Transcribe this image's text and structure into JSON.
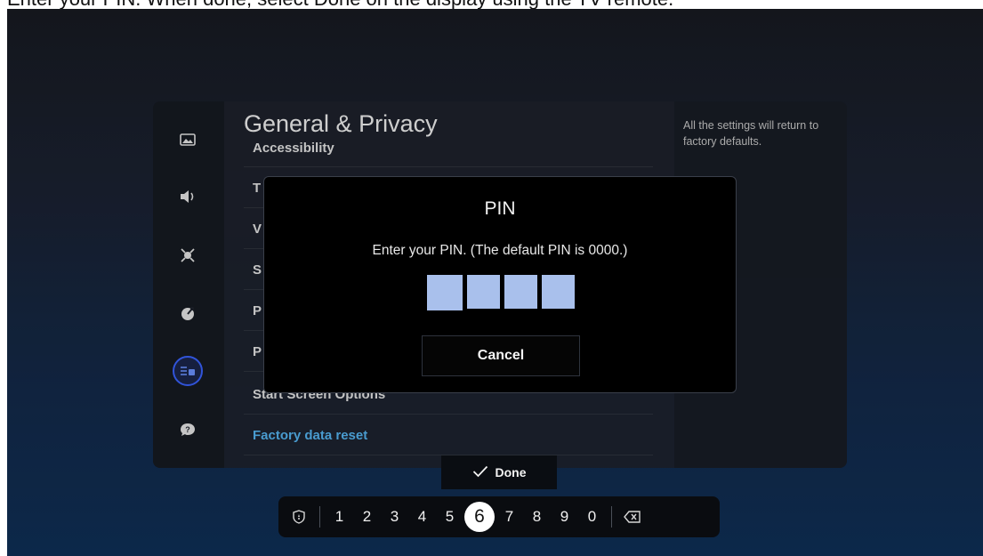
{
  "caption": "Enter your PIN. When done, select Done on the display using the TV remote.",
  "panel": {
    "title": "General & Privacy",
    "items": [
      "Accessibility",
      "T",
      "V",
      "S",
      "P",
      "P",
      "Start Screen Options",
      "Factory data reset"
    ],
    "active_item": "Factory data reset",
    "help_text": "All the settings will return to factory defaults."
  },
  "sidebar": {
    "icons": [
      "picture-icon",
      "sound-icon",
      "connection-icon",
      "broadcast-icon",
      "general-icon",
      "support-icon"
    ],
    "selected": "general-icon",
    "accent": "#3a63ff"
  },
  "dialog": {
    "title": "PIN",
    "message": "Enter your PIN. (The default PIN is 0000.)",
    "pin_length": 4,
    "cancel_label": "Cancel"
  },
  "done_label": "Done",
  "keypad": {
    "digits": [
      "1",
      "2",
      "3",
      "4",
      "5",
      "6",
      "7",
      "8",
      "9",
      "0"
    ],
    "focused": "6"
  },
  "colors": {
    "pin_box": "#a9c0ec",
    "active_item": "#56b7f4"
  }
}
